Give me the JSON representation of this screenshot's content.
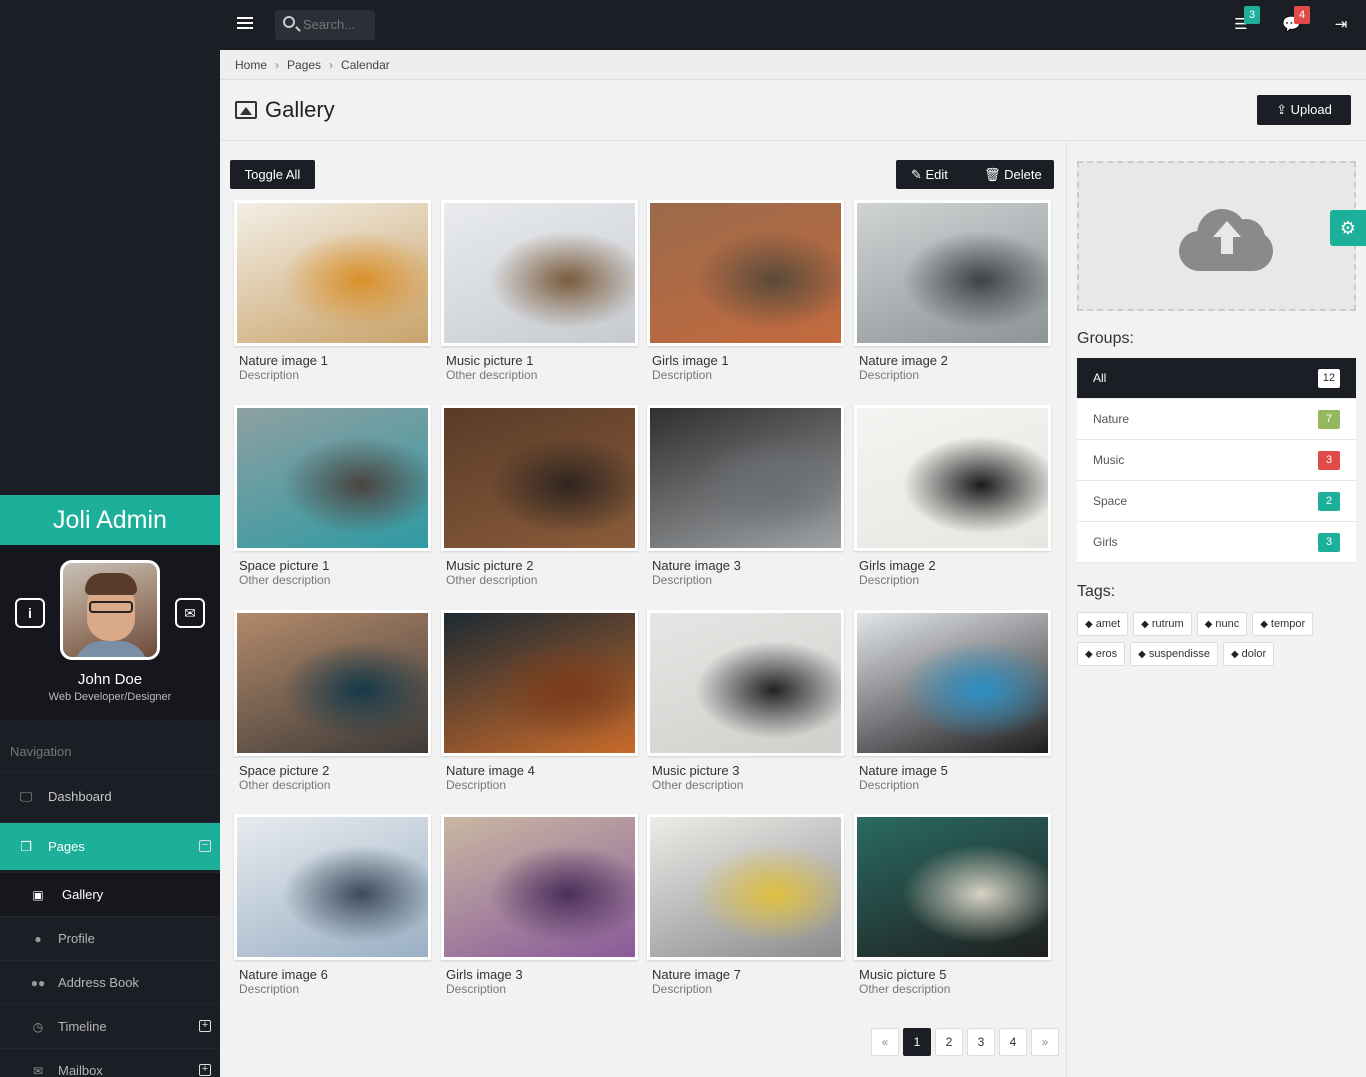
{
  "app": {
    "name": "Joli Admin"
  },
  "profile": {
    "name": "John Doe",
    "role": "Web Developer/Designer",
    "info_icon": "i",
    "mail_icon": "✉"
  },
  "nav": {
    "title": "Navigation",
    "items": [
      {
        "label": "Dashboard",
        "icon": "monitor-icon",
        "glyph": "🖵"
      },
      {
        "label": "Pages",
        "icon": "pages-icon",
        "glyph": "❐",
        "toggle": "−"
      }
    ],
    "sub_items": [
      {
        "label": "Gallery",
        "icon": "image-icon",
        "glyph": "▣"
      },
      {
        "label": "Profile",
        "icon": "user-icon",
        "glyph": "●"
      },
      {
        "label": "Address Book",
        "icon": "users-icon",
        "glyph": "●●"
      },
      {
        "label": "Timeline",
        "icon": "clock-icon",
        "glyph": "◷",
        "toggle": "+"
      },
      {
        "label": "Mailbox",
        "icon": "mail-icon",
        "glyph": "✉",
        "toggle": "+"
      }
    ]
  },
  "topbar": {
    "search_placeholder": "Search...",
    "tasks_badge": "3",
    "messages_badge": "4"
  },
  "breadcrumb": [
    "Home",
    "Pages",
    "Calendar"
  ],
  "page": {
    "title": "Gallery",
    "upload_label": "Upload"
  },
  "toolbar": {
    "toggle_all": "Toggle All",
    "edit": "Edit",
    "delete": "Delete"
  },
  "gallery": [
    {
      "title": "Nature image 1",
      "desc": "Description",
      "colors": [
        "#f3efe6",
        "#c9a26a",
        "#d9902a"
      ]
    },
    {
      "title": "Music picture 1",
      "desc": "Other description",
      "colors": [
        "#e9ebee",
        "#c7cbd0",
        "#7a5a3c"
      ]
    },
    {
      "title": "Girls image 1",
      "desc": "Description",
      "colors": [
        "#9a6a4a",
        "#c46a3e",
        "#5a4a3a"
      ]
    },
    {
      "title": "Nature image 2",
      "desc": "Description",
      "colors": [
        "#cfd3d4",
        "#8d9496",
        "#3e4244"
      ]
    },
    {
      "title": "Space picture 1",
      "desc": "Other description",
      "colors": [
        "#8ea0a2",
        "#2f9aa3",
        "#4a4440"
      ]
    },
    {
      "title": "Music picture 2",
      "desc": "Other description",
      "colors": [
        "#5a3b28",
        "#8a5c3a",
        "#2f2520"
      ]
    },
    {
      "title": "Nature image 3",
      "desc": "Description",
      "colors": [
        "#2e2f31",
        "#9fa2a4",
        "#6c6f72"
      ]
    },
    {
      "title": "Girls image 2",
      "desc": "Description",
      "colors": [
        "#f4f4f2",
        "#e8e6e0",
        "#1b1b1b"
      ]
    },
    {
      "title": "Space picture 2",
      "desc": "Other description",
      "colors": [
        "#b38a6a",
        "#3e3a38",
        "#163a4a"
      ]
    },
    {
      "title": "Nature image 4",
      "desc": "Description",
      "colors": [
        "#1c2a33",
        "#c86a2a",
        "#7a3a1a"
      ]
    },
    {
      "title": "Music picture 3",
      "desc": "Other description",
      "colors": [
        "#e6e6e4",
        "#cfcfcc",
        "#222222"
      ]
    },
    {
      "title": "Nature image 5",
      "desc": "Description",
      "colors": [
        "#e4e7ea",
        "#1e1e20",
        "#2a8fc4"
      ]
    },
    {
      "title": "Nature image 6",
      "desc": "Description",
      "colors": [
        "#e7ebef",
        "#9ab0c4",
        "#3a4a5a"
      ]
    },
    {
      "title": "Girls image 3",
      "desc": "Description",
      "colors": [
        "#c9b8a2",
        "#8a5a9a",
        "#4a2e5a"
      ]
    },
    {
      "title": "Nature image 7",
      "desc": "Description",
      "colors": [
        "#eeece8",
        "#8a8c8e",
        "#e0c040"
      ]
    },
    {
      "title": "Music picture 5",
      "desc": "Other description",
      "colors": [
        "#2a6a62",
        "#1f2020",
        "#d8d2c4"
      ]
    }
  ],
  "pagination": {
    "prev": "«",
    "pages": [
      "1",
      "2",
      "3",
      "4"
    ],
    "active": "1",
    "next": "»"
  },
  "sidebar_right": {
    "groups_title": "Groups:",
    "groups": [
      {
        "label": "All",
        "count": "12",
        "color": "white"
      },
      {
        "label": "Nature",
        "count": "7",
        "color": "olive"
      },
      {
        "label": "Music",
        "count": "3",
        "color": "red"
      },
      {
        "label": "Space",
        "count": "2",
        "color": "teal"
      },
      {
        "label": "Girls",
        "count": "3",
        "color": "teal"
      }
    ],
    "tags_title": "Tags:",
    "tags": [
      "amet",
      "rutrum",
      "nunc",
      "tempor",
      "eros",
      "suspendisse",
      "dolor"
    ]
  }
}
